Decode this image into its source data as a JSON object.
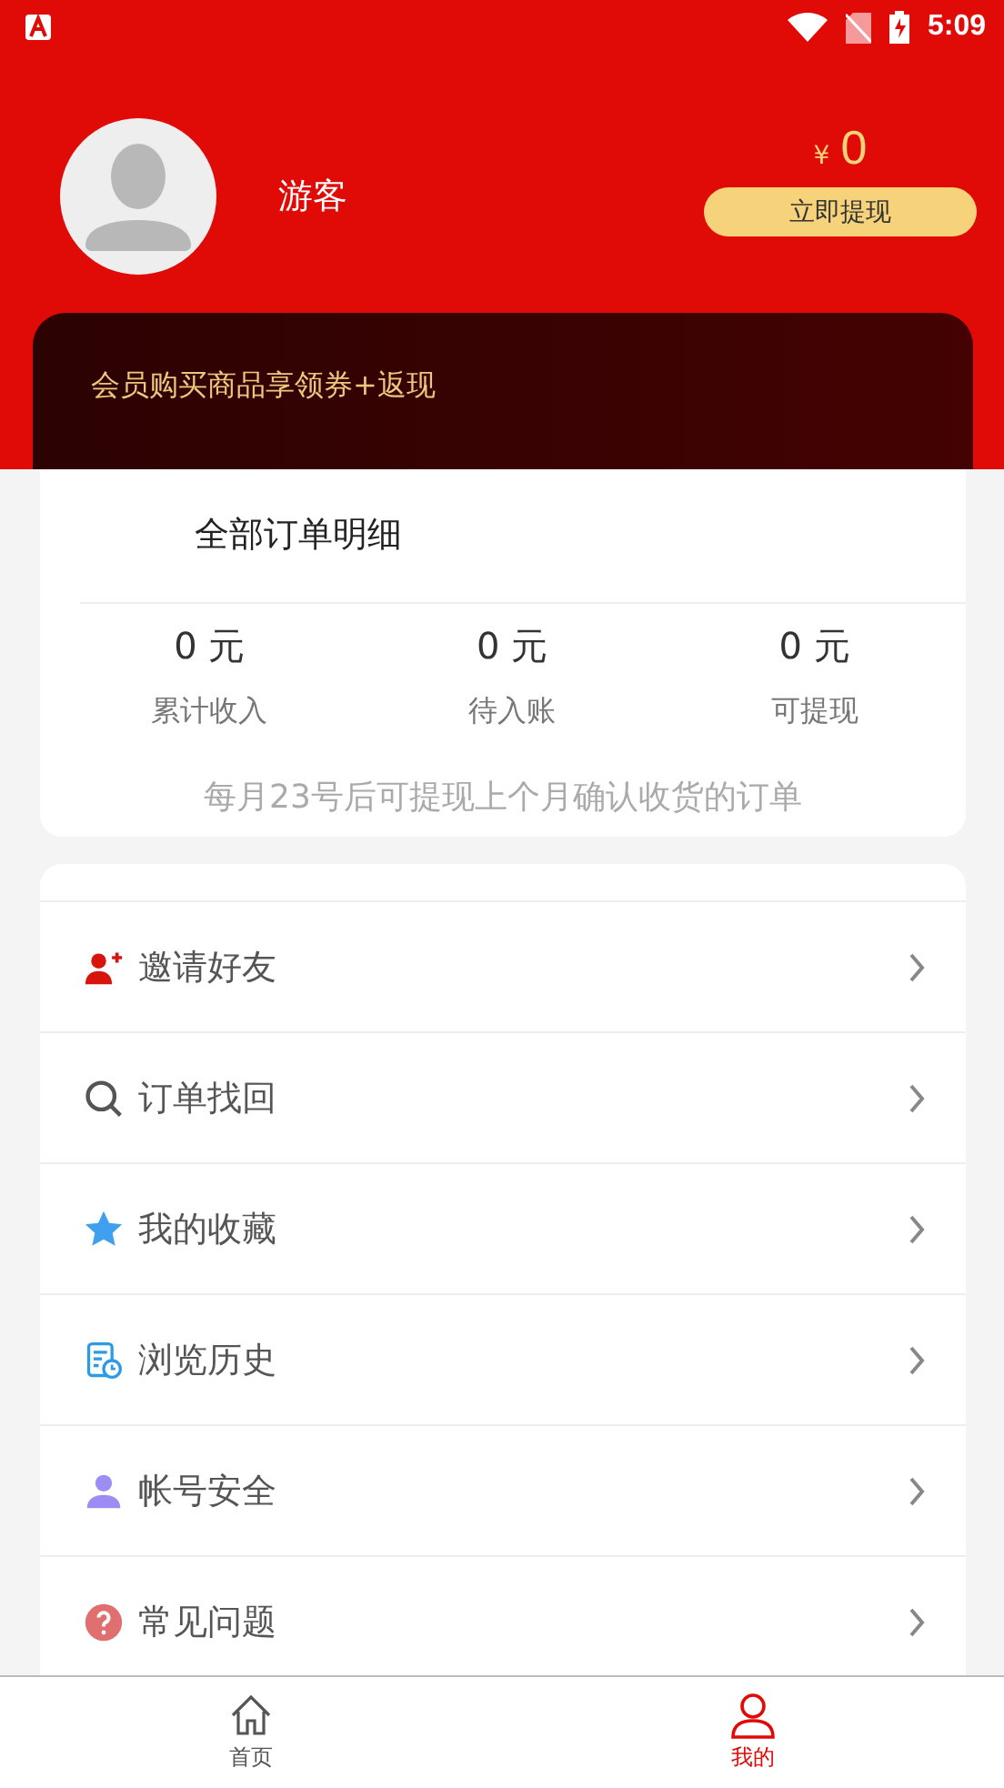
{
  "status_bar": {
    "time": "5:09"
  },
  "profile": {
    "name": "游客",
    "currency": "¥",
    "balance": "0",
    "withdraw_button": "立即提现"
  },
  "banner": {
    "text": "会员购买商品享领券+返现"
  },
  "orders": {
    "title": "全部订单明细",
    "stats": [
      {
        "value": "0 元",
        "label": "累计收入"
      },
      {
        "value": "0 元",
        "label": "待入账"
      },
      {
        "value": "0 元",
        "label": "可提现"
      }
    ],
    "note": "每月23号后可提现上个月确认收货的订单"
  },
  "menu": [
    {
      "kind": "invite",
      "label": "邀请好友"
    },
    {
      "kind": "search",
      "label": "订单找回"
    },
    {
      "kind": "star",
      "label": "我的收藏"
    },
    {
      "kind": "history",
      "label": "浏览历史"
    },
    {
      "kind": "account",
      "label": "帐号安全"
    },
    {
      "kind": "help",
      "label": "常见问题"
    }
  ],
  "tabs": [
    {
      "kind": "home",
      "label": "首页",
      "selected": false
    },
    {
      "kind": "me",
      "label": "我的",
      "selected": true
    }
  ]
}
